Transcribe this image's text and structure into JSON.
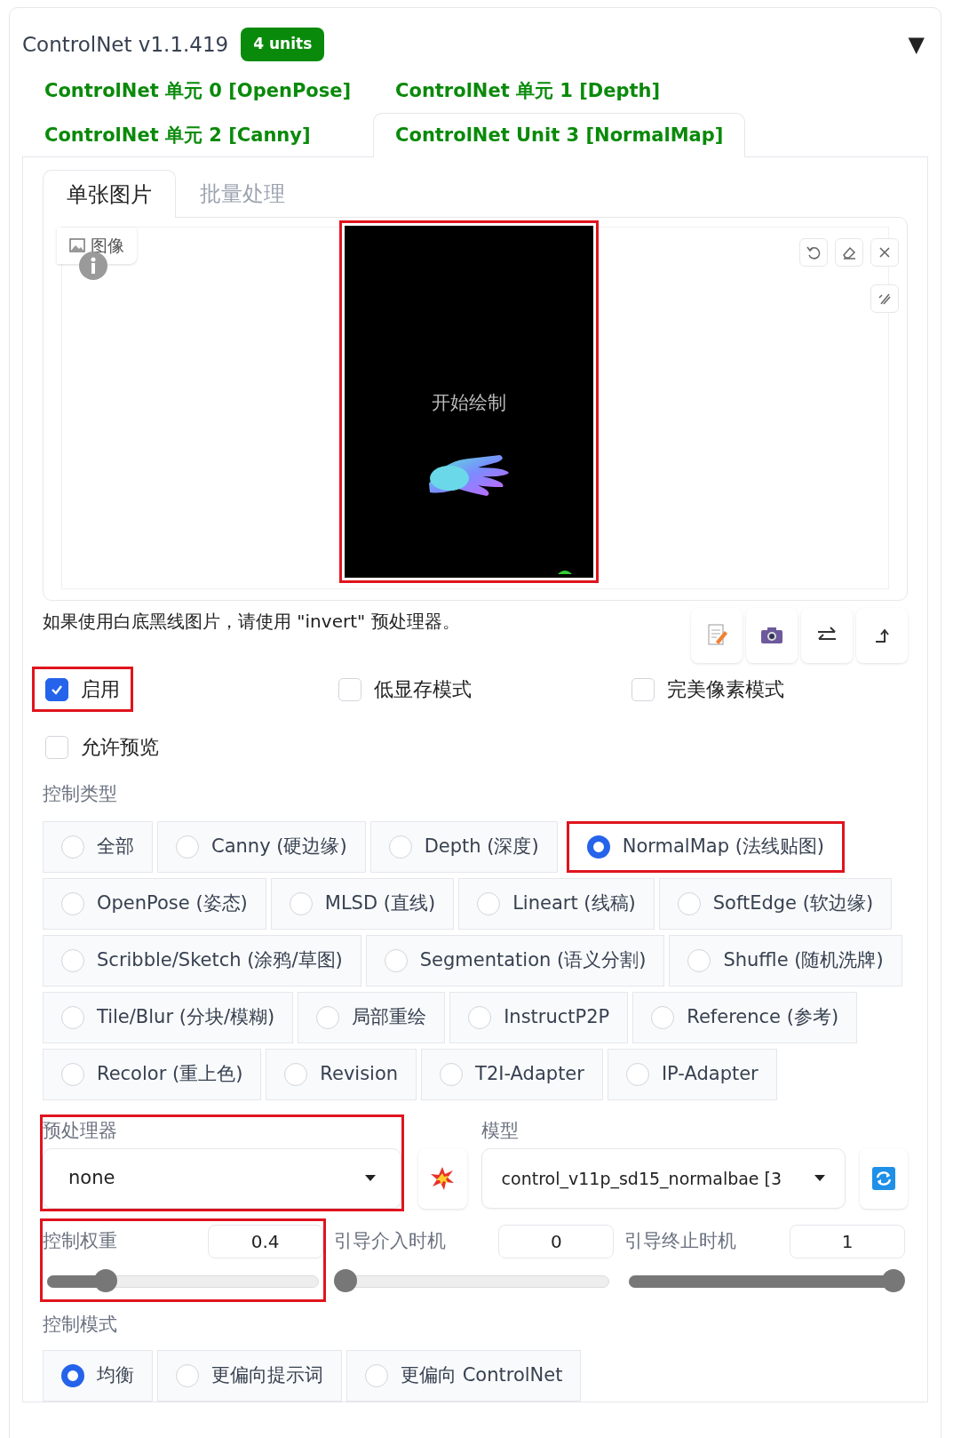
{
  "header": {
    "title": "ControlNet v1.1.419",
    "badge": "4 units",
    "toggle": "▼"
  },
  "unit_tabs": [
    {
      "label": "ControlNet 单元 0 [OpenPose]",
      "selected": false
    },
    {
      "label": "ControlNet 单元 1 [Depth]",
      "selected": false
    },
    {
      "label": "ControlNet 单元 2 [Canny]",
      "selected": false
    },
    {
      "label": "ControlNet Unit 3 [NormalMap]",
      "selected": true
    }
  ],
  "input_tabs": [
    {
      "label": "单张图片",
      "selected": true
    },
    {
      "label": "批量处理",
      "selected": false
    }
  ],
  "image_input": {
    "label": "图像",
    "overlay_text": "开始绘制",
    "image": {
      "kind": "picture",
      "highlighted": true
    }
  },
  "hint": "如果使用白底黑线图片，请使用 \"invert\" 预处理器。",
  "checkboxes": [
    {
      "label": "启用",
      "checked": true,
      "highlighted": true
    },
    {
      "label": "低显存模式",
      "checked": false,
      "highlighted": false
    },
    {
      "label": "完美像素模式",
      "checked": false,
      "highlighted": false
    },
    {
      "label": "允许预览",
      "checked": false,
      "highlighted": false
    }
  ],
  "control_type": {
    "label": "控制类型",
    "options": [
      {
        "label": "全部",
        "selected": false,
        "highlighted": false
      },
      {
        "label": "Canny (硬边缘)",
        "selected": false,
        "highlighted": false
      },
      {
        "label": "Depth (深度)",
        "selected": false,
        "highlighted": false
      },
      {
        "label": "NormalMap (法线贴图)",
        "selected": true,
        "highlighted": true
      },
      {
        "label": "OpenPose (姿态)",
        "selected": false,
        "highlighted": false
      },
      {
        "label": "MLSD (直线)",
        "selected": false,
        "highlighted": false
      },
      {
        "label": "Lineart (线稿)",
        "selected": false,
        "highlighted": false
      },
      {
        "label": "SoftEdge (软边缘)",
        "selected": false,
        "highlighted": false
      },
      {
        "label": "Scribble/Sketch (涂鸦/草图)",
        "selected": false,
        "highlighted": false
      },
      {
        "label": "Segmentation (语义分割)",
        "selected": false,
        "highlighted": false
      },
      {
        "label": "Shuffle (随机洗牌)",
        "selected": false,
        "highlighted": false
      },
      {
        "label": "Tile/Blur (分块/模糊)",
        "selected": false,
        "highlighted": false
      },
      {
        "label": "局部重绘",
        "selected": false,
        "highlighted": false
      },
      {
        "label": "InstructP2P",
        "selected": false,
        "highlighted": false
      },
      {
        "label": "Reference (参考)",
        "selected": false,
        "highlighted": false
      },
      {
        "label": "Recolor (重上色)",
        "selected": false,
        "highlighted": false
      },
      {
        "label": "Revision",
        "selected": false,
        "highlighted": false
      },
      {
        "label": "T2I-Adapter",
        "selected": false,
        "highlighted": false
      },
      {
        "label": "IP-Adapter",
        "selected": false,
        "highlighted": false
      }
    ]
  },
  "preprocessor": {
    "label": "预处理器",
    "value": "none",
    "highlighted": true
  },
  "model": {
    "label": "模型",
    "value": "control_v11p_sd15_normalbae [3"
  },
  "sliders": [
    {
      "label": "控制权重",
      "value": "0.4",
      "level": 0.2,
      "highlighted": true
    },
    {
      "label": "引导介入时机",
      "value": "0",
      "level": 0,
      "highlighted": false
    },
    {
      "label": "引导终止时机",
      "value": "1",
      "level": 1,
      "highlighted": false
    }
  ],
  "control_mode": {
    "label": "控制模式",
    "options": [
      {
        "label": "均衡",
        "selected": true
      },
      {
        "label": "更偏向提示词",
        "selected": false
      },
      {
        "label": "更偏向 ControlNet",
        "selected": false
      }
    ]
  }
}
